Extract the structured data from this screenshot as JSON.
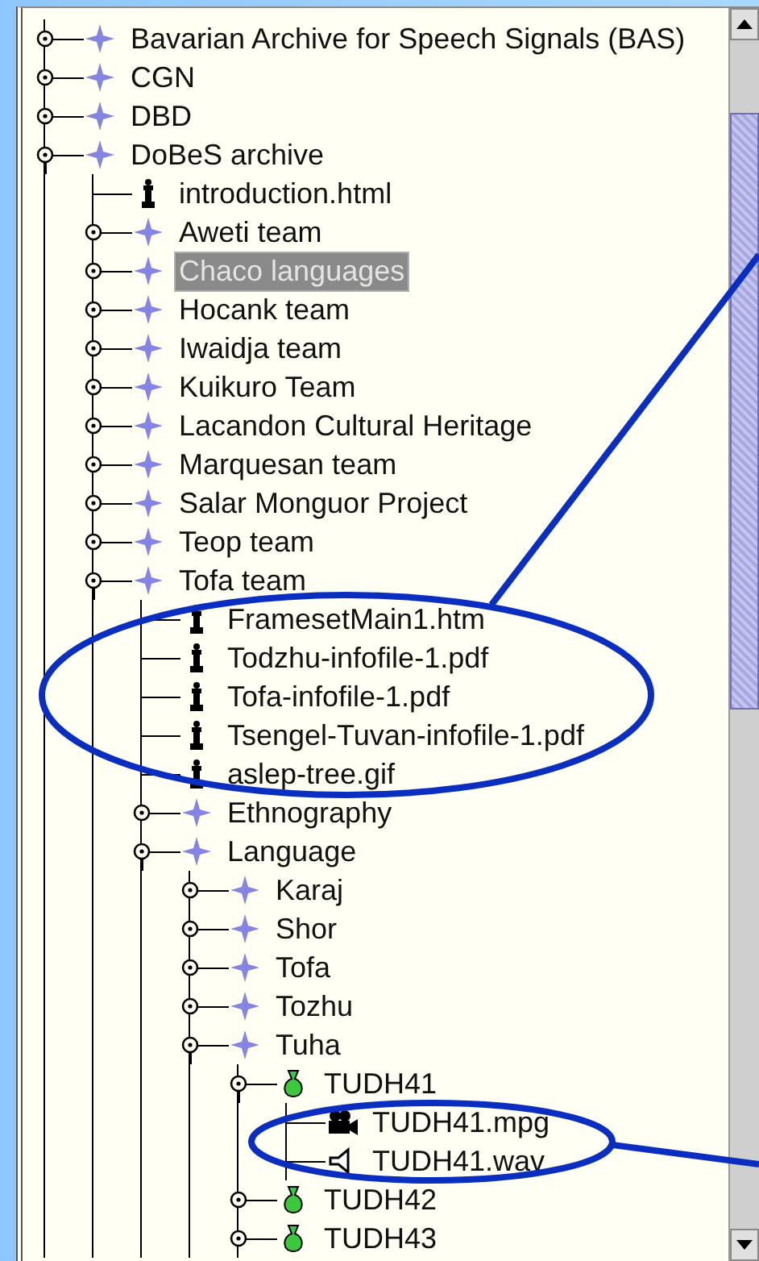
{
  "tree": {
    "items": [
      {
        "label": "Bavarian Archive for Speech Signals (BAS)",
        "kind": "folder",
        "selected": false,
        "expanded": false
      },
      {
        "label": "CGN",
        "kind": "folder",
        "selected": false,
        "expanded": false
      },
      {
        "label": "DBD",
        "kind": "folder",
        "selected": false,
        "expanded": false
      },
      {
        "label": "DoBeS archive",
        "kind": "folder",
        "selected": false,
        "expanded": true,
        "children": [
          {
            "label": "introduction.html",
            "kind": "file",
            "selected": false
          },
          {
            "label": "Aweti team",
            "kind": "folder",
            "selected": false,
            "expanded": false
          },
          {
            "label": "Chaco languages",
            "kind": "folder",
            "selected": true,
            "expanded": false
          },
          {
            "label": "Hocank team",
            "kind": "folder",
            "selected": false,
            "expanded": false
          },
          {
            "label": "Iwaidja team",
            "kind": "folder",
            "selected": false,
            "expanded": false
          },
          {
            "label": "Kuikuro Team",
            "kind": "folder",
            "selected": false,
            "expanded": false
          },
          {
            "label": "Lacandon Cultural Heritage",
            "kind": "folder",
            "selected": false,
            "expanded": false
          },
          {
            "label": "Marquesan team",
            "kind": "folder",
            "selected": false,
            "expanded": false
          },
          {
            "label": "Salar Monguor Project",
            "kind": "folder",
            "selected": false,
            "expanded": false
          },
          {
            "label": "Teop team",
            "kind": "folder",
            "selected": false,
            "expanded": false
          },
          {
            "label": "Tofa team",
            "kind": "folder",
            "selected": false,
            "expanded": true,
            "children": [
              {
                "label": "FramesetMain1.htm",
                "kind": "file",
                "selected": false
              },
              {
                "label": "Todzhu-infofile-1.pdf",
                "kind": "file",
                "selected": false
              },
              {
                "label": "Tofa-infofile-1.pdf",
                "kind": "file",
                "selected": false
              },
              {
                "label": "Tsengel-Tuvan-infofile-1.pdf",
                "kind": "file",
                "selected": false
              },
              {
                "label": "aslep-tree.gif",
                "kind": "file",
                "selected": false
              },
              {
                "label": "Ethnography",
                "kind": "folder",
                "selected": false,
                "expanded": false
              },
              {
                "label": "Language",
                "kind": "folder",
                "selected": false,
                "expanded": true,
                "children": [
                  {
                    "label": "Karaj",
                    "kind": "folder",
                    "selected": false,
                    "expanded": false
                  },
                  {
                    "label": "Shor",
                    "kind": "folder",
                    "selected": false,
                    "expanded": false
                  },
                  {
                    "label": "Tofa",
                    "kind": "folder",
                    "selected": false,
                    "expanded": false
                  },
                  {
                    "label": "Tozhu",
                    "kind": "folder",
                    "selected": false,
                    "expanded": false
                  },
                  {
                    "label": "Tuha",
                    "kind": "folder",
                    "selected": false,
                    "expanded": true,
                    "children": [
                      {
                        "label": "TUDH41",
                        "kind": "session",
                        "selected": false,
                        "expanded": true,
                        "children": [
                          {
                            "label": "TUDH41.mpg",
                            "kind": "video",
                            "selected": false
                          },
                          {
                            "label": "TUDH41.wav",
                            "kind": "audio",
                            "selected": false
                          }
                        ]
                      },
                      {
                        "label": "TUDH42",
                        "kind": "session",
                        "selected": false,
                        "expanded": false
                      },
                      {
                        "label": "TUDH43",
                        "kind": "session",
                        "selected": false,
                        "expanded": false
                      }
                    ]
                  }
                ]
              }
            ]
          }
        ]
      }
    ]
  }
}
